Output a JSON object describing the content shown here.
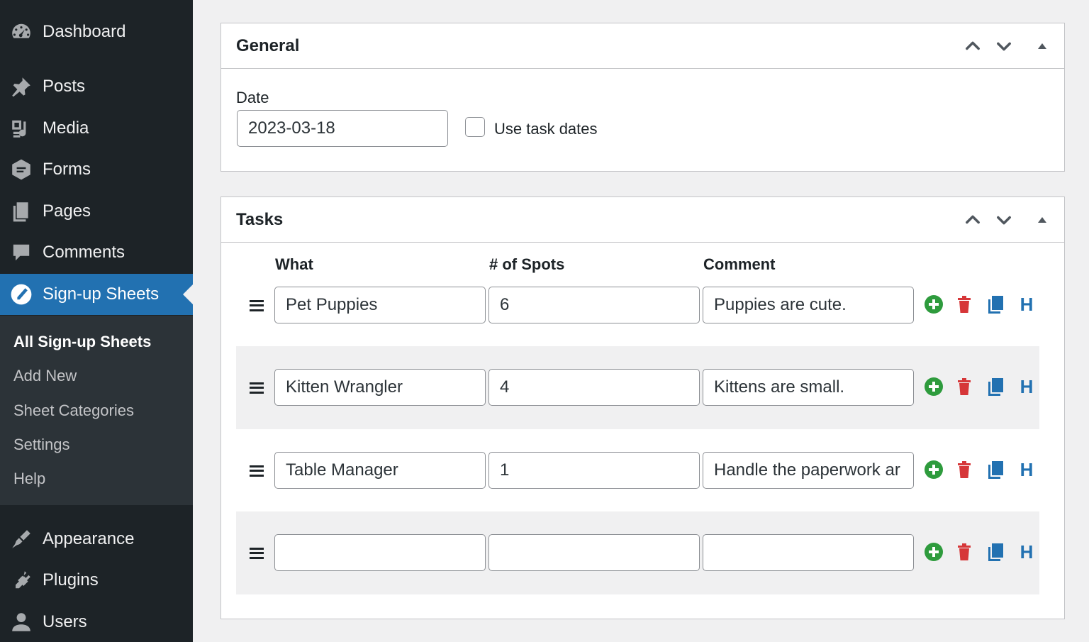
{
  "sidebar": {
    "menu": [
      {
        "id": "dashboard",
        "label": "Dashboard",
        "icon": "dashboard-icon"
      },
      {
        "id": "posts",
        "label": "Posts",
        "icon": "pushpin-icon"
      },
      {
        "id": "media",
        "label": "Media",
        "icon": "media-icon"
      },
      {
        "id": "forms",
        "label": "Forms",
        "icon": "forms-icon"
      },
      {
        "id": "pages",
        "label": "Pages",
        "icon": "pages-icon"
      },
      {
        "id": "comments",
        "label": "Comments",
        "icon": "comment-icon"
      },
      {
        "id": "signup",
        "label": "Sign-up Sheets",
        "icon": "signup-sheets-icon",
        "current": true
      },
      {
        "id": "appearance",
        "label": "Appearance",
        "icon": "paintbrush-icon"
      },
      {
        "id": "plugins",
        "label": "Plugins",
        "icon": "plugin-icon"
      },
      {
        "id": "users",
        "label": "Users",
        "icon": "user-icon"
      }
    ],
    "submenu": [
      {
        "label": "All Sign-up Sheets",
        "current": true
      },
      {
        "label": "Add New"
      },
      {
        "label": "Sheet Categories"
      },
      {
        "label": "Settings"
      },
      {
        "label": "Help"
      }
    ]
  },
  "general": {
    "title": "General",
    "date_label": "Date",
    "date_value": "2023-03-18",
    "use_task_dates_label": "Use task dates",
    "use_task_dates_checked": false
  },
  "tasks": {
    "title": "Tasks",
    "columns": {
      "what": "What",
      "spots": "# of Spots",
      "comment": "Comment"
    },
    "rows": [
      {
        "what": "Pet Puppies",
        "spots": "6",
        "comment": "Puppies are cute."
      },
      {
        "what": "Kitten Wrangler",
        "spots": "4",
        "comment": "Kittens are small."
      },
      {
        "what": "Table Manager",
        "spots": "1",
        "comment": "Handle the paperwork ar"
      },
      {
        "what": "",
        "spots": "",
        "comment": ""
      }
    ],
    "header_action_label": "H"
  },
  "colors": {
    "sidebar_bg": "#1d2327",
    "accent": "#2271b1",
    "add_green": "#2e9b3d",
    "delete_red": "#d63638",
    "copy_blue": "#2271b1"
  }
}
